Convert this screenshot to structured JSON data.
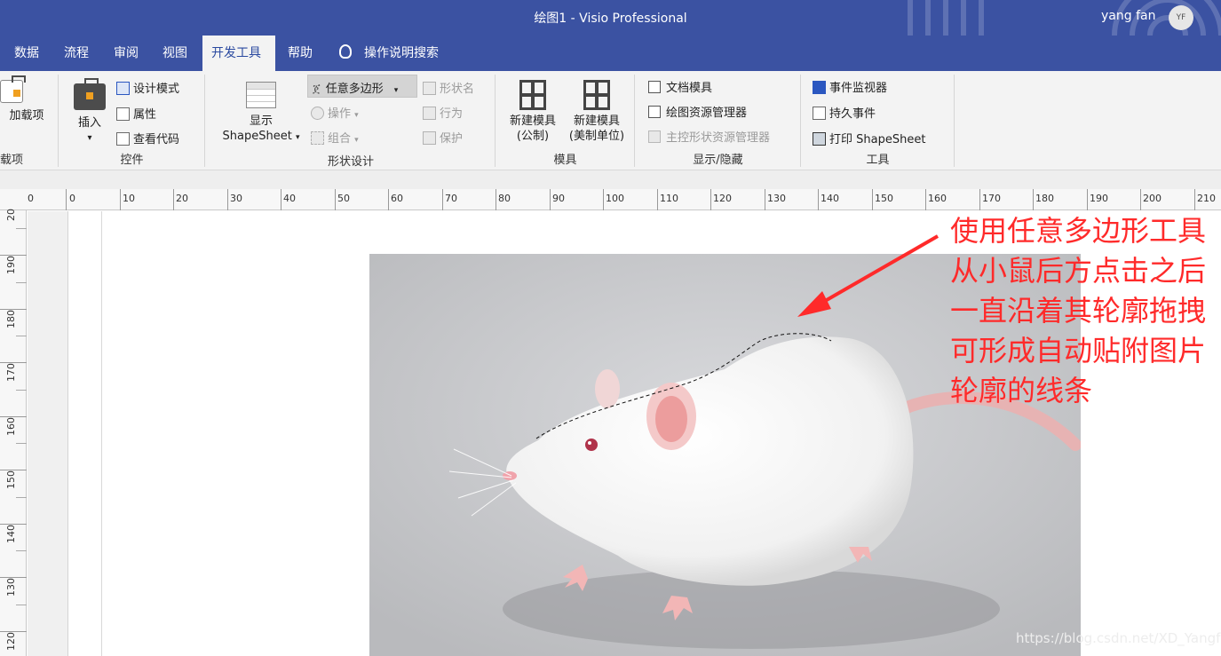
{
  "window": {
    "title": "绘图1  -  Visio Professional",
    "user_name": "yang fan",
    "avatar_initials": "YF",
    "accent_color": "#3b52a2"
  },
  "tabs": [
    {
      "label": "数据",
      "active": false
    },
    {
      "label": "流程",
      "active": false
    },
    {
      "label": "审阅",
      "active": false
    },
    {
      "label": "视图",
      "active": false
    },
    {
      "label": "开发工具",
      "active": true
    },
    {
      "label": "帮助",
      "active": false
    }
  ],
  "tell_me": {
    "label": "操作说明搜索",
    "icon": "lightbulb-icon"
  },
  "ribbon": {
    "addins": {
      "button_label": "加载项",
      "group_label": "载项"
    },
    "controls": {
      "insert_label": "插入",
      "insert_dropdown": "▾",
      "design_mode": "设计模式",
      "properties": "属性",
      "view_code": "查看代码",
      "group_label": "控件"
    },
    "shape_design": {
      "show_label": "显示",
      "shapesheet_label": "ShapeSheet",
      "dropdown": "▾",
      "freeform": "任意多边形",
      "operations": "操作",
      "group": "组合",
      "shape_name": "形状名",
      "behavior": "行为",
      "protection": "保护",
      "group_label": "形状设计"
    },
    "stencil": {
      "new_metric": "新建模具",
      "new_metric_sub": "(公制)",
      "new_us": "新建模具",
      "new_us_sub": "(美制单位)",
      "group_label": "模具"
    },
    "show_hide": {
      "document_stencil": "文档模具",
      "drawing_explorer": "绘图资源管理器",
      "master_explorer": "主控形状资源管理器",
      "group_label": "显示/隐藏"
    },
    "tools": {
      "event_monitor": "事件监视器",
      "persistent_events": "持久事件",
      "print_shapesheet": "打印 ShapeSheet",
      "group_label": "工具"
    }
  },
  "ruler": {
    "horizontal": [
      "0",
      "0",
      "10",
      "20",
      "30",
      "40",
      "50",
      "60",
      "70",
      "80",
      "90",
      "100",
      "110",
      "120",
      "130",
      "140",
      "150",
      "160",
      "170",
      "180",
      "190",
      "200",
      "210"
    ],
    "vertical": [
      "20",
      "190",
      "180",
      "170",
      "160",
      "150",
      "140",
      "130",
      "120"
    ]
  },
  "annotation": {
    "lines": [
      "使用任意多边形工具",
      "从小鼠后方点击之后",
      "一直沿着其轮廓拖拽",
      "可形成自动贴附图片",
      "轮廓的线条"
    ],
    "color": "#ff2a2a"
  },
  "watermark": "https://blog.csdn.net/XD_Yangf"
}
